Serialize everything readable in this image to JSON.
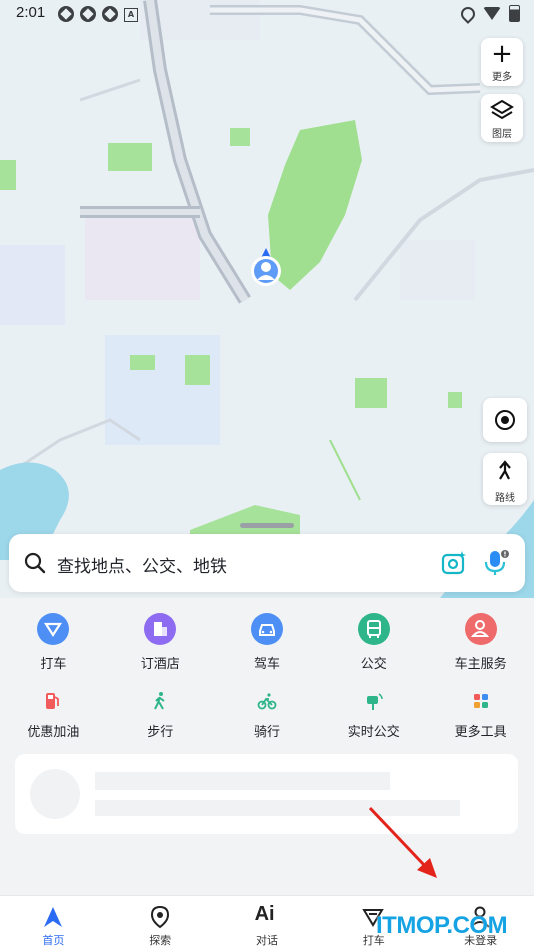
{
  "status_bar": {
    "time": "2:01"
  },
  "map_controls": {
    "more_label": "更多",
    "layers_label": "图层",
    "route_label": "路线"
  },
  "search": {
    "placeholder": "查找地点、公交、地铁"
  },
  "services_row1": [
    {
      "label": "打车",
      "color": "#4d8ff5"
    },
    {
      "label": "订酒店",
      "color": "#8d6cf2"
    },
    {
      "label": "驾车",
      "color": "#4d8ff5"
    },
    {
      "label": "公交",
      "color": "#2fb58a"
    },
    {
      "label": "车主服务",
      "color": "#ef6a6a"
    }
  ],
  "services_row2": [
    {
      "label": "优惠加油",
      "color": "#f25b5b"
    },
    {
      "label": "步行",
      "color": "#2fb58a"
    },
    {
      "label": "骑行",
      "color": "#2fb58a"
    },
    {
      "label": "实时公交",
      "color": "#2fb58a"
    },
    {
      "label": "更多工具",
      "color": "#f0a030"
    }
  ],
  "bottom_nav": [
    {
      "label": "首页",
      "active": true
    },
    {
      "label": "探索",
      "active": false
    },
    {
      "label": "对话",
      "active": false
    },
    {
      "label": "打车",
      "active": false
    },
    {
      "label": "未登录",
      "active": false
    }
  ],
  "watermark": "ITMOP.COM",
  "accent_color": "#2b6bf3"
}
